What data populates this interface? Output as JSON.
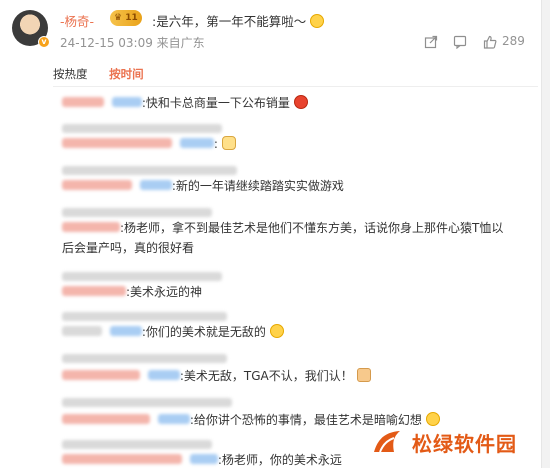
{
  "post": {
    "username": "-杨奇-",
    "vip": "11",
    "text": ":是六年，第一年不能算啦～",
    "emoji": "grin-emoji",
    "meta": "24-12-15 03:09 来自广东",
    "like_count": "289"
  },
  "sort_tabs": [
    "按热度",
    "按时间"
  ],
  "active_tab": "按时间",
  "comments": [
    {
      "text": ":快和卡总商量一下公布销量",
      "emoji": "angry-emoji"
    },
    {
      "text": ":",
      "emoji": "dog-emoji"
    },
    {
      "text": ":新的一年请继续踏踏实实做游戏"
    },
    {
      "text": ":杨老师，拿不到最佳艺术是他们不懂东方美，话说你身上那件心猿T恤以",
      "text2": "后会量产吗，真的很好看"
    },
    {
      "text": ":美术永远的神"
    },
    {
      "text": ":你们的美术就是无敌的",
      "emoji": "cry-emoji"
    },
    {
      "text": ":美术无敌，TGA不认，我们认！",
      "emoji": "thumb-emoji"
    },
    {
      "text": ":给你讲个恐怖的事情，最佳艺术是暗喻幻想",
      "emoji": "sweat-emoji"
    },
    {
      "text": ":杨老师，你的美术永远"
    }
  ],
  "watermark": "松绿软件园",
  "colors": {
    "accent": "#eb7350",
    "watermark": "#e35a16"
  }
}
